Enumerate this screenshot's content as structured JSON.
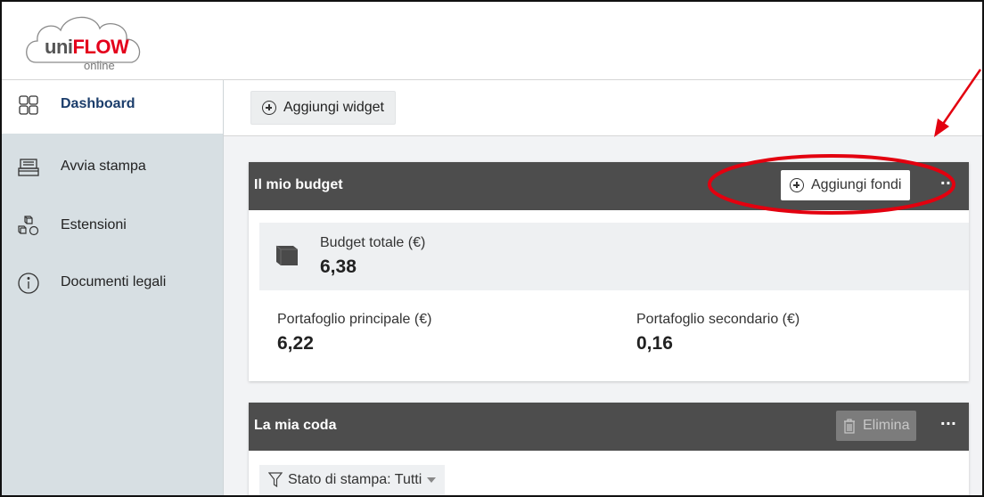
{
  "logo": {
    "uni": "uni",
    "flow": "FLOW",
    "online": "online"
  },
  "sidebar": {
    "items": [
      {
        "label": "Dashboard",
        "icon": "dashboard-grid-icon",
        "active": true
      },
      {
        "label": "Avvia stampa",
        "icon": "printer-icon",
        "active": false
      },
      {
        "label": "Estensioni",
        "icon": "cubes-icon",
        "active": false
      },
      {
        "label": "Documenti legali",
        "icon": "info-circle-icon",
        "active": false
      }
    ]
  },
  "toolbar": {
    "add_widget_label": "Aggiungi widget"
  },
  "budget_card": {
    "title": "Il mio budget",
    "add_funds_label": "Aggiungi fondi",
    "more_label": "···",
    "total_label": "Budget totale (€)",
    "total_value": "6,38",
    "main_wallet_label": "Portafoglio principale (€)",
    "main_wallet_value": "6,22",
    "secondary_wallet_label": "Portafoglio secondario (€)",
    "secondary_wallet_value": "0,16"
  },
  "queue_card": {
    "title": "La mia coda",
    "delete_label": "Elimina",
    "more_label": "···",
    "filter_label": "Stato di stampa: Tutti"
  },
  "colors": {
    "sidebar_bg": "#d7dfe3",
    "card_header": "#4d4d4d",
    "brand_red": "#e4001b",
    "annotation_red": "#e3000f"
  }
}
